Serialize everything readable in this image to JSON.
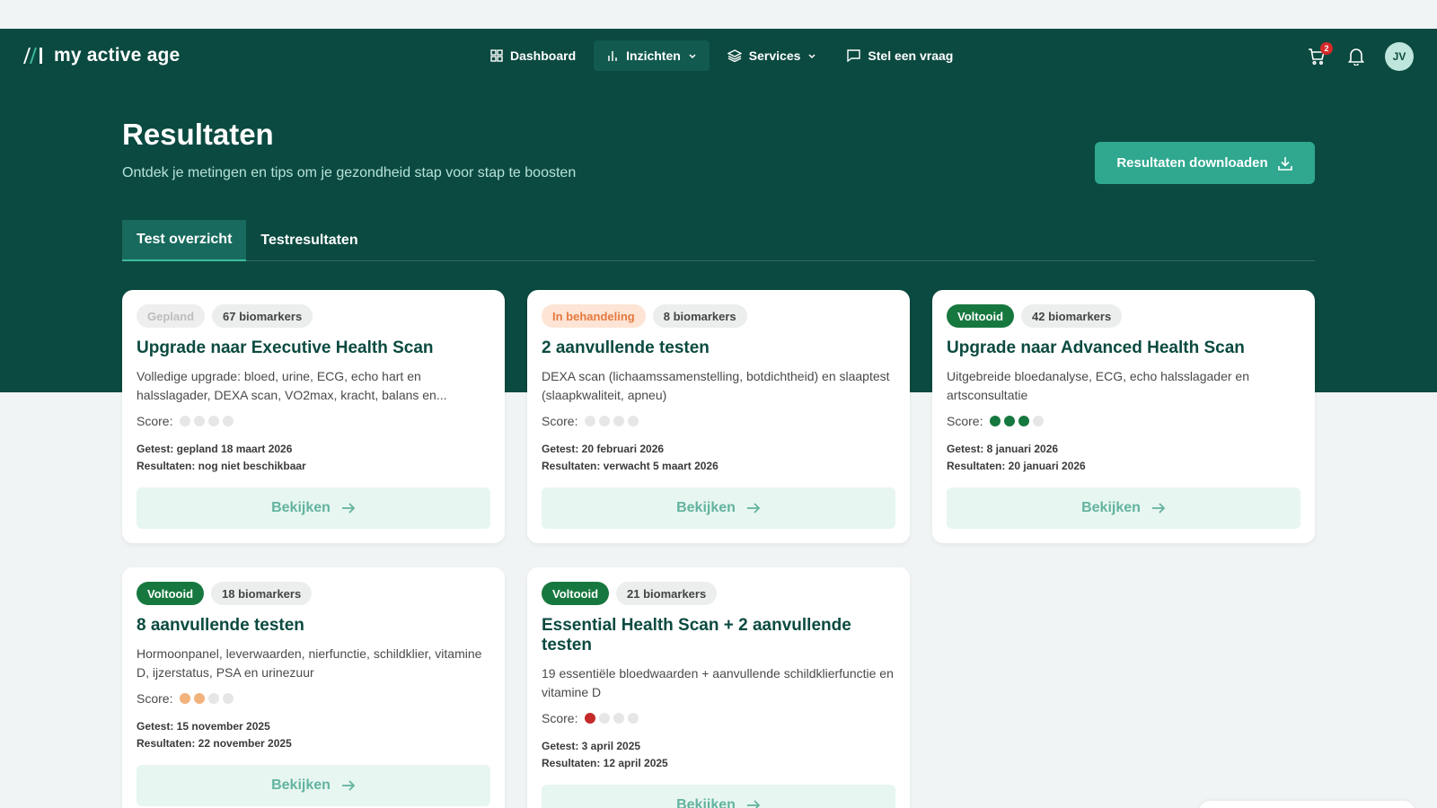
{
  "nav": {
    "brand": "my active age",
    "items": [
      {
        "label": "Dashboard",
        "icon": "grid-icon",
        "active": false,
        "has_dropdown": false
      },
      {
        "label": "Inzichten",
        "icon": "bar-chart-icon",
        "active": true,
        "has_dropdown": true
      },
      {
        "label": "Services",
        "icon": "layers-icon",
        "active": false,
        "has_dropdown": true
      },
      {
        "label": "Stel een vraag",
        "icon": "chat-icon",
        "active": false,
        "has_dropdown": false
      }
    ],
    "cart_count": "2",
    "avatar_initials": "JV"
  },
  "header": {
    "title": "Resultaten",
    "subtitle": "Ontdek je metingen en tips om je gezondheid stap voor stap te boosten",
    "download_label": "Resultaten downloaden"
  },
  "tabs": [
    {
      "label": "Test overzicht",
      "active": true
    },
    {
      "label": "Testresultaten",
      "active": false
    }
  ],
  "cards": [
    {
      "status": "Gepland",
      "status_type": "gepland",
      "biomarkers": "67 biomarkers",
      "title": "Upgrade naar Executive Health Scan",
      "description": "Volledige upgrade: bloed, urine, ECG, echo hart en halsslagader, DEXA scan, VO2max, kracht, balans en...",
      "score_label": "Score:",
      "score_dots": [
        "#e6e6e6",
        "#e6e6e6",
        "#e6e6e6",
        "#e6e6e6"
      ],
      "tested": "Getest: gepland 18 maart 2026",
      "results": "Resultaten: nog niet beschikbaar",
      "button": "Bekijken"
    },
    {
      "status": "In behandeling",
      "status_type": "behandeling",
      "biomarkers": "8 biomarkers",
      "title": "2 aanvullende testen",
      "description": "DEXA scan (lichaamssamenstelling, botdichtheid) en slaaptest (slaapkwaliteit, apneu)",
      "score_label": "Score:",
      "score_dots": [
        "#e6e6e6",
        "#e6e6e6",
        "#e6e6e6",
        "#e6e6e6"
      ],
      "tested": "Getest: 20 februari 2026",
      "results": "Resultaten: verwacht 5 maart 2026",
      "button": "Bekijken"
    },
    {
      "status": "Voltooid",
      "status_type": "voltooid",
      "biomarkers": "42 biomarkers",
      "title": "Upgrade naar Advanced Health Scan",
      "description": "Uitgebreide bloedanalyse, ECG, echo halsslagader en artsconsultatie",
      "score_label": "Score:",
      "score_dots": [
        "#17783f",
        "#17783f",
        "#17783f",
        "#e6e6e6"
      ],
      "tested": "Getest: 8 januari 2026",
      "results": "Resultaten: 20 januari 2026",
      "button": "Bekijken"
    },
    {
      "status": "Voltooid",
      "status_type": "voltooid",
      "biomarkers": "18 biomarkers",
      "title": "8 aanvullende testen",
      "description": "Hormoonpanel, leverwaarden, nierfunctie, schildklier, vitamine D, ijzerstatus, PSA en urinezuur",
      "score_label": "Score:",
      "score_dots": [
        "#f2b27c",
        "#f2b27c",
        "#e6e6e6",
        "#e6e6e6"
      ],
      "tested": "Getest: 15 november 2025",
      "results": "Resultaten: 22 november 2025",
      "button": "Bekijken"
    },
    {
      "status": "Voltooid",
      "status_type": "voltooid",
      "biomarkers": "21 biomarkers",
      "title": "Essential Health Scan + 2 aanvullende testen",
      "description": "19 essentiële bloedwaarden + aanvullende schildklierfunctie en vitamine D",
      "score_label": "Score:",
      "score_dots": [
        "#c42a2a",
        "#e6e6e6",
        "#e6e6e6",
        "#e6e6e6"
      ],
      "tested": "Getest: 3 april 2025",
      "results": "Resultaten: 12 april 2025",
      "button": "Bekijken"
    }
  ]
}
